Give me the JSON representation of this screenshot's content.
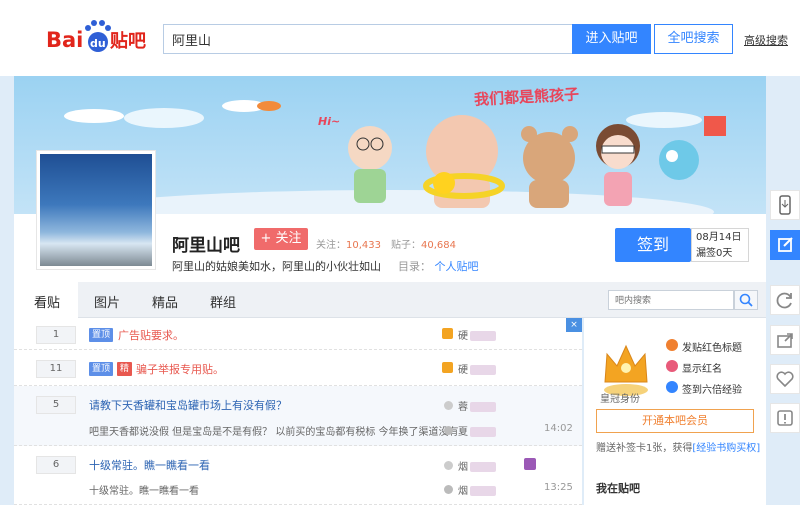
{
  "header": {
    "logo": "Bai du 贴吧",
    "search_value": "阿里山",
    "enter_button": "进入贴吧",
    "all_search_button": "全吧搜索",
    "advanced_search": "高级搜索"
  },
  "banner": {
    "slogan": "我们都是熊孩子",
    "hi": "Hi~"
  },
  "forum": {
    "name": "阿里山吧",
    "follow_label": "+ 关注",
    "followers_label": "关注：",
    "followers": "10,433",
    "posts_label": "贴子：",
    "posts": "40,684",
    "slogan": "阿里山的姑娘美如水，阿里山的小伙壮如山",
    "catalog_label": "目录：",
    "catalog_value": "个人贴吧",
    "sign_button": "签到",
    "sign_date": "08月14日",
    "sign_missed": "漏签0天"
  },
  "tabs": [
    "看贴",
    "图片",
    "精品",
    "群组"
  ],
  "forum_search_placeholder": "吧内搜索",
  "threads": [
    {
      "replies": "1",
      "tags": [
        "置顶"
      ],
      "title": "广告贴要求。",
      "title_color": "red",
      "abstract": "",
      "author": "硬",
      "time": ""
    },
    {
      "replies": "11",
      "tags": [
        "置顶",
        "精"
      ],
      "title": "骗子举报专用贴。",
      "title_color": "red",
      "abstract": "",
      "author": "硬",
      "time": ""
    },
    {
      "replies": "5",
      "tags": [],
      "title": "请教下天香罐和宝岛罐市场上有没有假？",
      "title_color": "blue",
      "abstract": "吧里天香都说没假 但是宝岛是不是有假？ 以前买的宝岛都有税标 今年换了渠道没有",
      "author": "蓉",
      "last_reply": "夏",
      "time": "14:02"
    },
    {
      "replies": "6",
      "tags": [],
      "title": "十级常驻。瞧一瞧看一看",
      "title_color": "blue",
      "abstract": "十级常驻。瞧一瞧看一看",
      "author": "烟",
      "last_reply": "烟",
      "time": "13:25"
    }
  ],
  "sidebar": {
    "crown_label": "皇冠身份",
    "perks": [
      "发贴红色标题",
      "显示红名",
      "签到六倍经验"
    ],
    "vip_button": "开通本吧会员",
    "sign_note_prefix": "赠送补签卡1张，获得",
    "sign_note_link": "[经验书购买权]",
    "in_forum": "我在贴吧"
  },
  "corner_close": "×",
  "colors": {
    "accent": "#3385ff",
    "red": "#e8584f",
    "follow": "#f06b6b"
  }
}
